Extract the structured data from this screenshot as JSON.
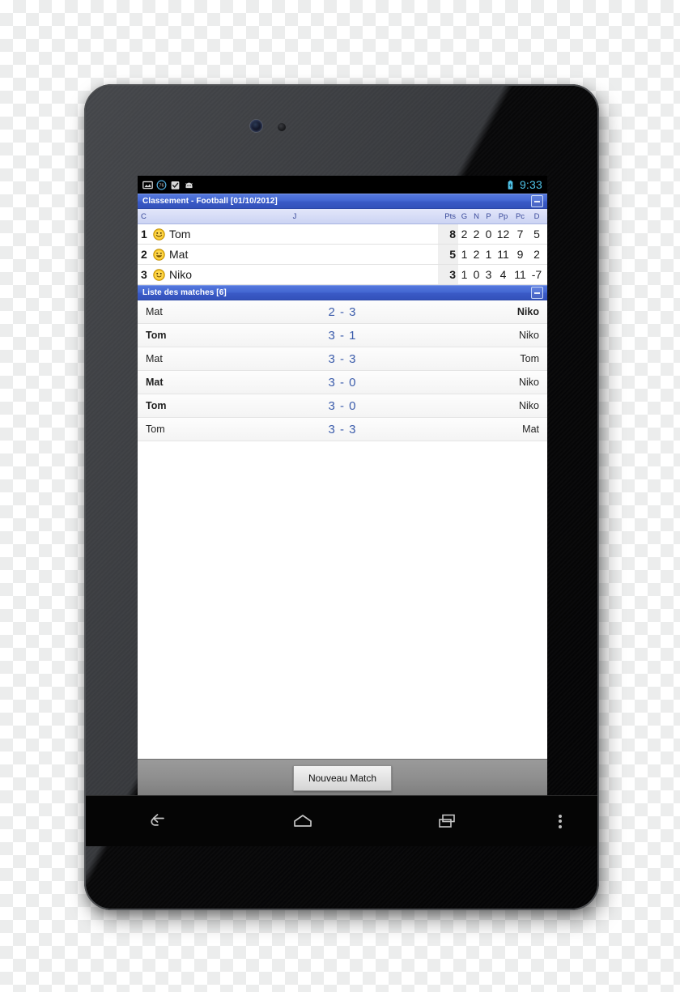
{
  "status_bar": {
    "time": "9:33",
    "left_icons": [
      "image-icon",
      "download-badge-76-icon",
      "checkbox-checked-icon",
      "android-robot-icon"
    ],
    "badge_value": "76",
    "right_icons": [
      "battery-icon"
    ],
    "clock_color": "#4fc3e8"
  },
  "standings_panel": {
    "title": "Classement - Football [01/10/2012]",
    "collapse_label": "collapse",
    "accent_color": "#3a5ac6",
    "columns": [
      "C",
      "J",
      "Pts",
      "G",
      "N",
      "P",
      "Pp",
      "Pc",
      "D"
    ],
    "rows": [
      {
        "rank": "1",
        "face": "smiley-neutral",
        "name": "Tom",
        "pts": "8",
        "g": "2",
        "n": "2",
        "p": "0",
        "pp": "12",
        "pc": "7",
        "d": "5"
      },
      {
        "rank": "2",
        "face": "smiley-grin",
        "name": "Mat",
        "pts": "5",
        "g": "1",
        "n": "2",
        "p": "1",
        "pp": "11",
        "pc": "9",
        "d": "2"
      },
      {
        "rank": "3",
        "face": "smiley-small",
        "name": "Niko",
        "pts": "3",
        "g": "1",
        "n": "0",
        "p": "3",
        "pp": "4",
        "pc": "11",
        "d": "-7"
      }
    ]
  },
  "matches_panel": {
    "title": "Liste des matches [6]",
    "collapse_label": "collapse",
    "rows": [
      {
        "home": "Mat",
        "score": "2 - 3",
        "away": "Niko",
        "home_bold": false,
        "away_bold": true
      },
      {
        "home": "Tom",
        "score": "3 - 1",
        "away": "Niko",
        "home_bold": true,
        "away_bold": false
      },
      {
        "home": "Mat",
        "score": "3 - 3",
        "away": "Tom",
        "home_bold": false,
        "away_bold": false
      },
      {
        "home": "Mat",
        "score": "3 - 0",
        "away": "Niko",
        "home_bold": true,
        "away_bold": false
      },
      {
        "home": "Tom",
        "score": "3 - 0",
        "away": "Niko",
        "home_bold": true,
        "away_bold": false
      },
      {
        "home": "Tom",
        "score": "3 - 3",
        "away": "Mat",
        "home_bold": false,
        "away_bold": false
      }
    ]
  },
  "bottom_bar": {
    "new_match_label": "Nouveau Match"
  },
  "nav_bar": {
    "items": [
      "back-icon",
      "home-icon",
      "recents-icon",
      "overflow-menu-icon"
    ]
  }
}
